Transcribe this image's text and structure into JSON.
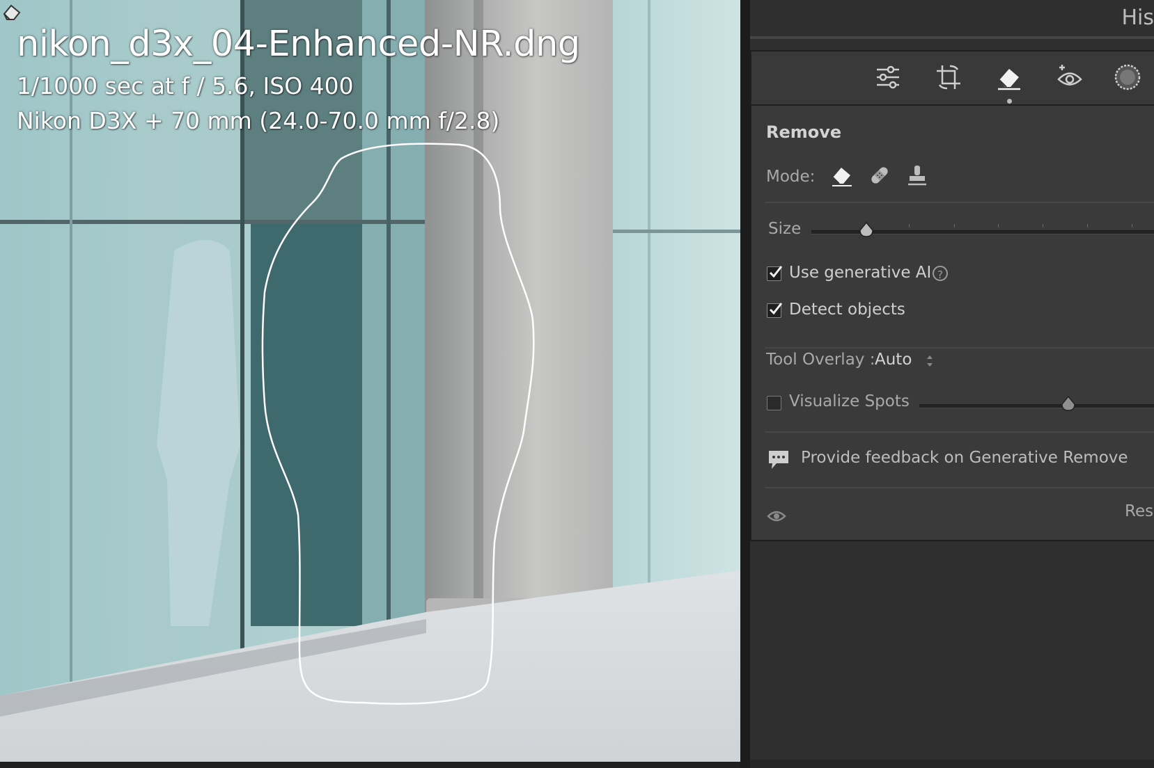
{
  "photo": {
    "file_name": "nikon_d3x_04-Enhanced-NR.dng",
    "exposure_info": "1/1000 sec at f / 5.6, ISO 400",
    "camera_lens": "Nikon D3X + 70 mm (24.0-70.0 mm f/2.8)"
  },
  "panel": {
    "history_tab": "His",
    "tools": [
      "sliders-icon",
      "crop-icon",
      "eraser-icon",
      "redeye-icon",
      "mask-icon"
    ],
    "active_tool": "eraser-icon",
    "remove": {
      "title": "Remove",
      "mode_label": "Mode:",
      "modes": [
        "remove-mode-icon",
        "heal-mode-icon",
        "clone-mode-icon"
      ],
      "size_label": "Size",
      "size_value": 0.16,
      "use_generative_ai_label": "Use generative AI",
      "use_generative_ai": true,
      "help_glyph": "?",
      "detect_objects_label": "Detect objects",
      "detect_objects": true,
      "tool_overlay_label": "Tool Overlay :",
      "tool_overlay_value": "Auto",
      "visualize_spots_label": "Visualize Spots",
      "visualize_spots": false,
      "visualize_value": 0.63,
      "feedback_label": "Provide feedback on Generative Remove",
      "reset_label": "Rese"
    }
  },
  "colors": {
    "panel_bg": "#3a3a3a",
    "text": "#cfcfcf",
    "photo_glass": "#a8cbcd"
  }
}
